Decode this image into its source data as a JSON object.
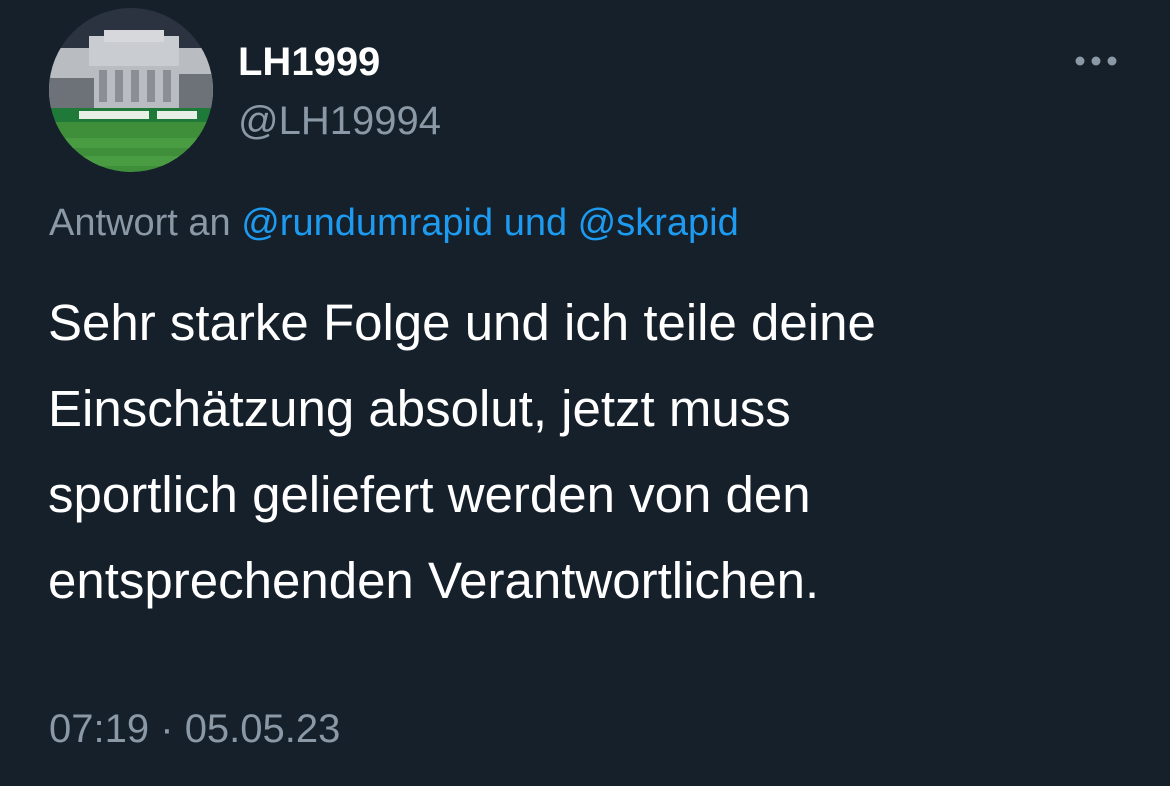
{
  "author": {
    "display_name": "LH1999",
    "handle": "@LH19994",
    "avatar_icon": "stadium-photo-avatar"
  },
  "more_icon": "more-dots-icon",
  "reply": {
    "prefix": "Antwort an",
    "mention_1": "@rundumrapid",
    "joiner": "und",
    "mention_2": "@skrapid"
  },
  "tweet": {
    "lines": [
      "Sehr starke Folge und ich teile deine",
      "Einschätzung absolut, jetzt muss",
      "sportlich geliefert werden von den",
      "entsprechenden Verantwortlichen."
    ]
  },
  "meta": {
    "time": "07:19",
    "separator": "·",
    "date": "05.05.23"
  },
  "colors": {
    "background": "#15202b",
    "primary_text": "#ffffff",
    "secondary_text": "#8b98a5",
    "link": "#1d9bf0"
  }
}
